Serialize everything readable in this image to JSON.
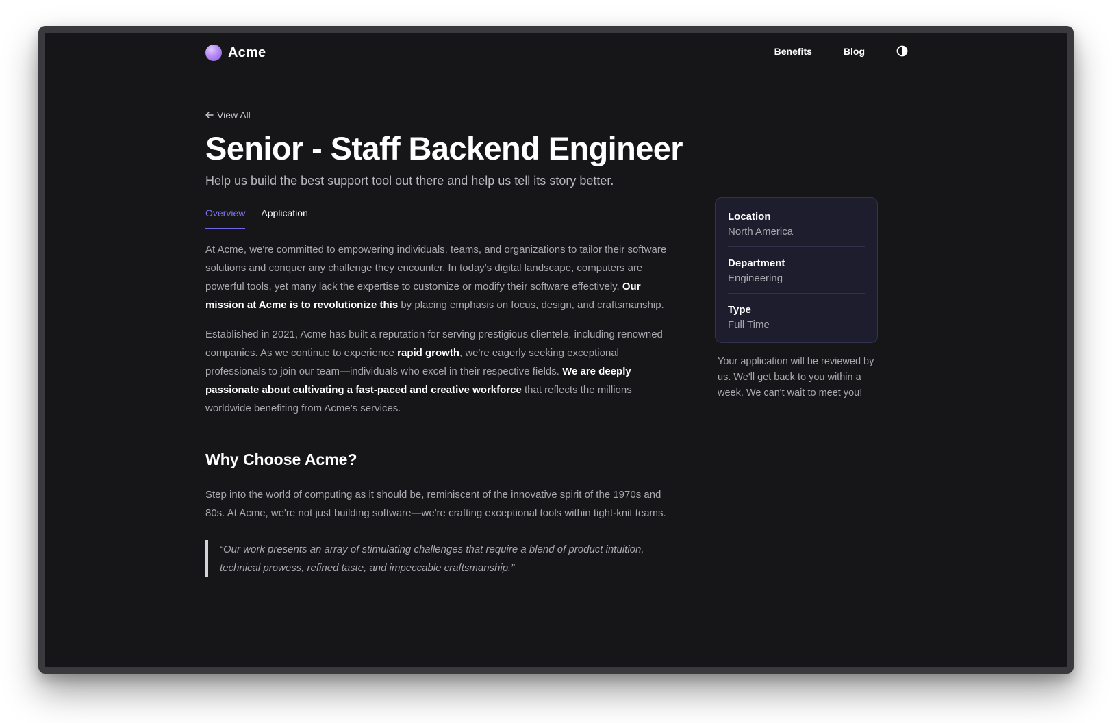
{
  "brand": {
    "name": "Acme",
    "accent": "#6f66ea",
    "logo_color": "#b68bf5"
  },
  "nav": {
    "items": [
      {
        "label": "Benefits"
      },
      {
        "label": "Blog"
      }
    ],
    "theme_toggle_icon": "half-circle-contrast-icon"
  },
  "job": {
    "back_label": "View All",
    "title": "Senior - Staff Backend Engineer",
    "subtitle": "Help us build the best support tool out there and help us tell its story better."
  },
  "tabs": [
    {
      "label": "Overview",
      "active": true
    },
    {
      "label": "Application",
      "active": false
    }
  ],
  "body": {
    "p1": {
      "a": "At Acme, we're committed to empowering individuals, teams, and organizations to tailor their software solutions and conquer any challenge they encounter. In today's digital landscape, computers are powerful tools, yet many lack the expertise to customize or modify their software effectively. ",
      "strong": "Our mission at Acme is to revolutionize this",
      "b": " by placing emphasis on focus, design, and craftsmanship."
    },
    "p2": {
      "a": "Established in 2021, Acme has built a reputation for serving prestigious clientele, including renowned companies. As we continue to experience ",
      "link": "rapid growth",
      "b": ", we're eagerly seeking exceptional professionals to join our team—individuals who excel in their respective fields. ",
      "strong": "We are deeply passionate about cultivating a fast-paced and creative workforce",
      "c": " that reflects the millions worldwide benefiting from Acme's services."
    },
    "section_title": "Why Choose Acme?",
    "p3": "Step into the world of computing as it should be, reminiscent of the innovative spirit of the 1970s and 80s. At Acme, we're not just building software—we're crafting exceptional tools within tight-knit teams.",
    "quote": "“Our work presents an array of stimulating challenges that require a blend of product intuition, technical prowess, refined taste, and impeccable craftsmanship.”"
  },
  "details": [
    {
      "label": "Location",
      "value": "North America"
    },
    {
      "label": "Department",
      "value": "Engineering"
    },
    {
      "label": "Type",
      "value": "Full Time"
    }
  ],
  "note": "Your application will be reviewed by us. We'll get back to you within a week. We can't wait to meet you!"
}
